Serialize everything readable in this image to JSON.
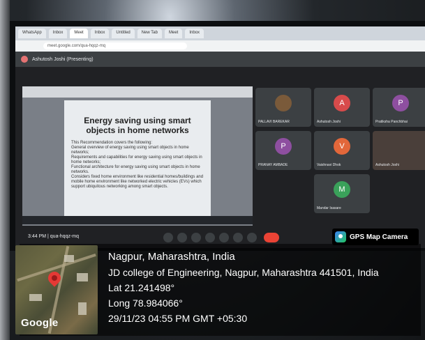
{
  "meet": {
    "presenter_label": "Ashutosh Joshi (Presenting)",
    "url": "meet.google.com/qua-hqqz-mq",
    "time_code": "3:44 PM | qua-hqqz-mq",
    "tabs": [
      "WhatsApp",
      "Inbox",
      "Meet",
      "Inbox",
      "Untitled",
      "New Tab",
      "Meet",
      "Inbox"
    ]
  },
  "slide": {
    "title": "Energy saving using smart objects in home networks",
    "bullets": [
      "This Recommendation covers the following:",
      "General overview of energy saving using smart objects in home networks;",
      "Requirements and capabilities for energy saving using smart objects in home networks;",
      "Functional architecture for energy saving using smart objects in home networks.",
      "Considers fixed home environment like residential homes/buildings and mobile home environment like networked electric vehicles (EVs) which support ubiquitous networking among smart objects."
    ]
  },
  "participants": [
    {
      "name": "PALLAVI BAREKAR",
      "initial": "",
      "color": "#3c4043"
    },
    {
      "name": "Ashutosh Joshi",
      "initial": "A",
      "color": "#d84b4b"
    },
    {
      "name": "Pratiksha Panchbhai",
      "initial": "P",
      "color": "#8e4fa0"
    },
    {
      "name": "PRANAY AMBADE",
      "initial": "P",
      "color": "#8e4fa0"
    },
    {
      "name": "Vaishnavi Dhok",
      "initial": "V",
      "color": "#e2673a"
    },
    {
      "name": "Ashutosh Joshi",
      "initial": "",
      "color": "#4a3f3a"
    },
    {
      "name": "Mandar Isasare",
      "initial": "M",
      "color": "#3aa15a"
    }
  ],
  "gps": {
    "badge_label": "GPS Map Camera",
    "city": "Nagpur, Maharashtra, India",
    "address": "JD college of Engineering, Nagpur, Maharashtra 441501, India",
    "lat": "Lat 21.241498°",
    "long": "Long 78.984066°",
    "datetime": "29/11/23 04:55 PM GMT +05:30",
    "map_brand": "Google"
  }
}
